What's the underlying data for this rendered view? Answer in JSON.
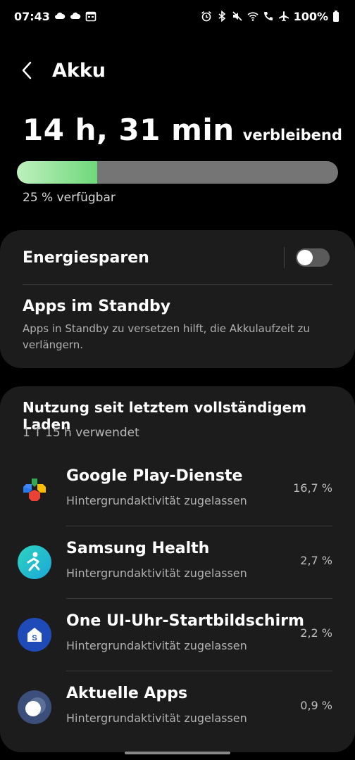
{
  "status_bar": {
    "time": "07:43",
    "battery": "100%",
    "left_icons": [
      "cloud-icon",
      "cloud-icon",
      "calendar-icon"
    ],
    "right_icons": [
      "alarm-icon",
      "bluetooth-icon",
      "mute-icon",
      "wifi-icon",
      "wifi-call-icon",
      "airplane-icon"
    ]
  },
  "header": {
    "title": "Akku"
  },
  "battery": {
    "remaining_time": "14 h, 31 min",
    "remaining_suffix": "verbleibend",
    "level_percent": 25,
    "available_text": "25 % verfügbar",
    "fill_color": "#6fd97a"
  },
  "energy": {
    "saver_label": "Energiesparen",
    "saver_on": false,
    "standby_title": "Apps im Standby",
    "standby_desc": "Apps in Standby zu versetzen hilft, die Akkulaufzeit zu verlängern."
  },
  "usage": {
    "title": "Nutzung seit letztem vollständigem Laden",
    "subtitle": "1 T 15 h verwendet",
    "apps": [
      {
        "name": "Google Play-Dienste",
        "status": "Hintergrundaktivität zugelassen",
        "percent": "16,7 %",
        "icon": "google-play-services-icon"
      },
      {
        "name": "Samsung Health",
        "status": "Hintergrundaktivität zugelassen",
        "percent": "2,7 %",
        "icon": "samsung-health-icon"
      },
      {
        "name": "One UI-Uhr-Startbildschirm",
        "status": "Hintergrundaktivität zugelassen",
        "percent": "2,2 %",
        "icon": "one-ui-watch-icon"
      },
      {
        "name": "Aktuelle Apps",
        "status": "Hintergrundaktivität zugelassen",
        "percent": "0,9 %",
        "icon": "recent-apps-icon"
      }
    ]
  }
}
